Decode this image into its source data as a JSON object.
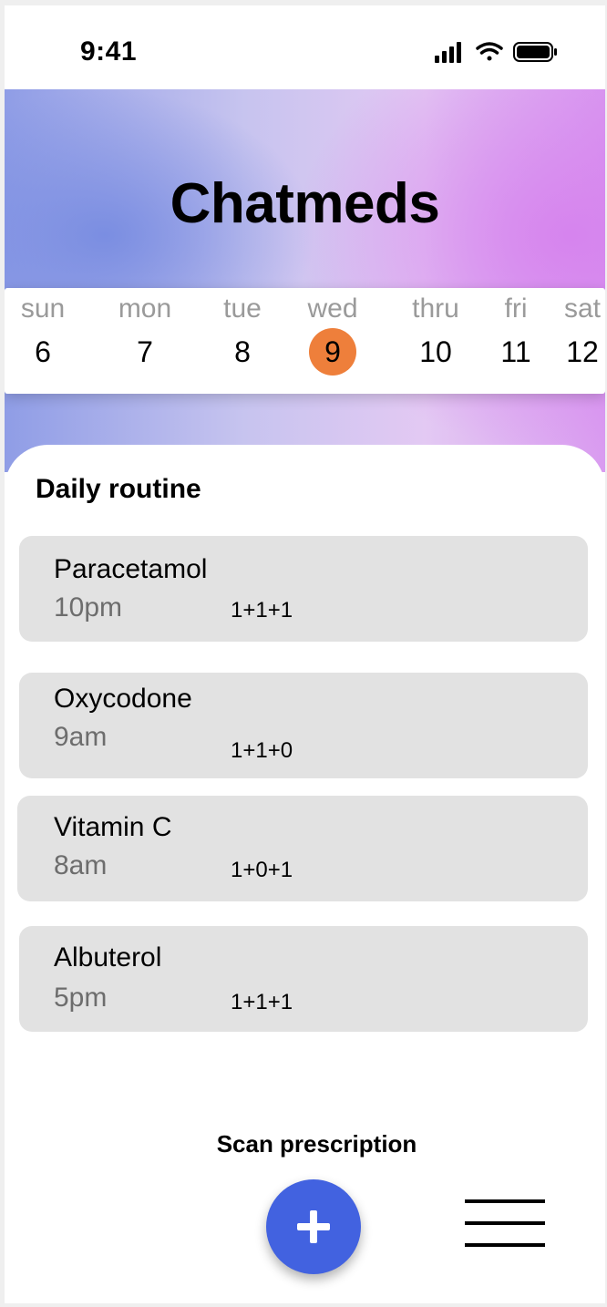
{
  "status_bar": {
    "time": "9:41",
    "icons": [
      "signal-icon",
      "wifi-icon",
      "battery-icon"
    ]
  },
  "header": {
    "title": "Chatmeds"
  },
  "calendar": {
    "days": [
      {
        "name": "sun",
        "number": "6",
        "selected": false
      },
      {
        "name": "mon",
        "number": "7",
        "selected": false
      },
      {
        "name": "tue",
        "number": "8",
        "selected": false
      },
      {
        "name": "wed",
        "number": "9",
        "selected": true
      },
      {
        "name": "thru",
        "number": "10",
        "selected": false
      },
      {
        "name": "fri",
        "number": "11",
        "selected": false
      },
      {
        "name": "sat",
        "number": "12",
        "selected": false
      }
    ],
    "selected_color": "#ee7f3b"
  },
  "routine": {
    "title": "Daily routine",
    "medications": [
      {
        "name": "Paracetamol",
        "time": "10pm",
        "dose": "1+1+1"
      },
      {
        "name": "Oxycodone",
        "time": "9am",
        "dose": "1+1+0"
      },
      {
        "name": "Vitamin C",
        "time": "8am",
        "dose": "1+0+1"
      },
      {
        "name": "Albuterol",
        "time": "5pm",
        "dose": "1+1+1"
      }
    ]
  },
  "footer": {
    "scan_label": "Scan prescription",
    "add_icon": "plus-icon",
    "menu_icon": "menu-icon",
    "accent_color": "#4262e0"
  }
}
